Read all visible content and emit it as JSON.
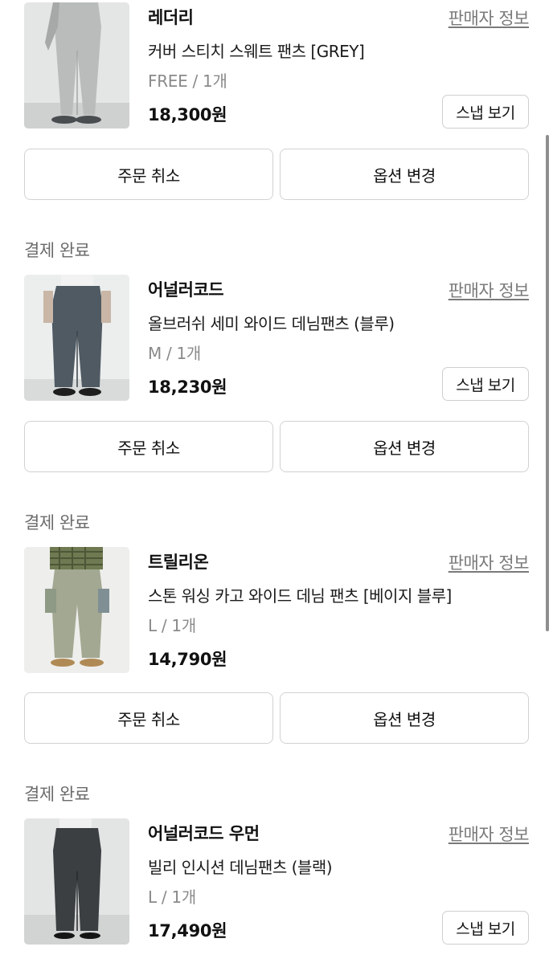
{
  "orders": [
    {
      "status": "",
      "seller": "레더리",
      "seller_link": "판매자 정보",
      "product_name": "커버 스티치 스웨트 팬츠 [GREY]",
      "option": "FREE / 1개",
      "price": "18,300원",
      "snap_label": "스냅 보기",
      "cancel_label": "주문 취소",
      "change_label": "옵션 변경"
    },
    {
      "status": "결제 완료",
      "seller": "어널러코드",
      "seller_link": "판매자 정보",
      "product_name": "올브러쉬 세미 와이드 데님팬츠 (블루)",
      "option": "M / 1개",
      "price": "18,230원",
      "snap_label": "스냅 보기",
      "cancel_label": "주문 취소",
      "change_label": "옵션 변경"
    },
    {
      "status": "결제 완료",
      "seller": "트릴리온",
      "seller_link": "판매자 정보",
      "product_name": "스톤 워싱 카고 와이드 데님 팬츠 [베이지 블루]",
      "option": "L / 1개",
      "price": "14,790원",
      "snap_label": "",
      "cancel_label": "주문 취소",
      "change_label": "옵션 변경"
    },
    {
      "status": "결제 완료",
      "seller": "어널러코드 우먼",
      "seller_link": "판매자 정보",
      "product_name": "빌리 인시션 데님팬츠 (블랙)",
      "option": "L / 1개",
      "price": "17,490원",
      "snap_label": "스냅 보기",
      "cancel_label": "",
      "change_label": ""
    }
  ],
  "colors": {
    "status_text": "#6b6b6b",
    "link_text": "#7a7a7a",
    "button_border": "#d2d2d2"
  }
}
